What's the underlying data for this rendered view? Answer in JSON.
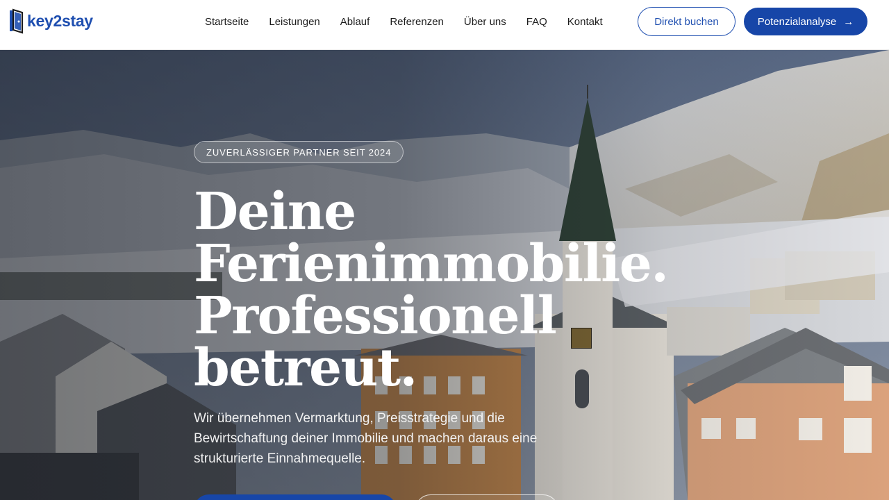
{
  "brand": {
    "name": "key2stay",
    "icon": "door-key-icon",
    "color": "#1f4fb0"
  },
  "nav": {
    "items": [
      {
        "label": "Startseite"
      },
      {
        "label": "Leistungen"
      },
      {
        "label": "Ablauf"
      },
      {
        "label": "Referenzen"
      },
      {
        "label": "Über uns"
      },
      {
        "label": "FAQ"
      },
      {
        "label": "Kontakt"
      }
    ],
    "book_label": "Direkt buchen",
    "analysis_label": "Potenzialanalyse",
    "analysis_icon": "arrow-right-icon",
    "accent": "#1746a8"
  },
  "hero": {
    "badge": "ZUVERLÄSSIGER PARTNER SEIT 2024",
    "headline_lines": [
      "Deine",
      "Ferienimmobilie.",
      "Professionell",
      "betreut."
    ],
    "subtext": "Wir übernehmen Vermarktung, Preisstrategie und die Bewirtschaftung deiner Immobilie und machen daraus eine strukturierte Einnahmequelle.",
    "background": "alpine-village-church-snow-mountains"
  }
}
